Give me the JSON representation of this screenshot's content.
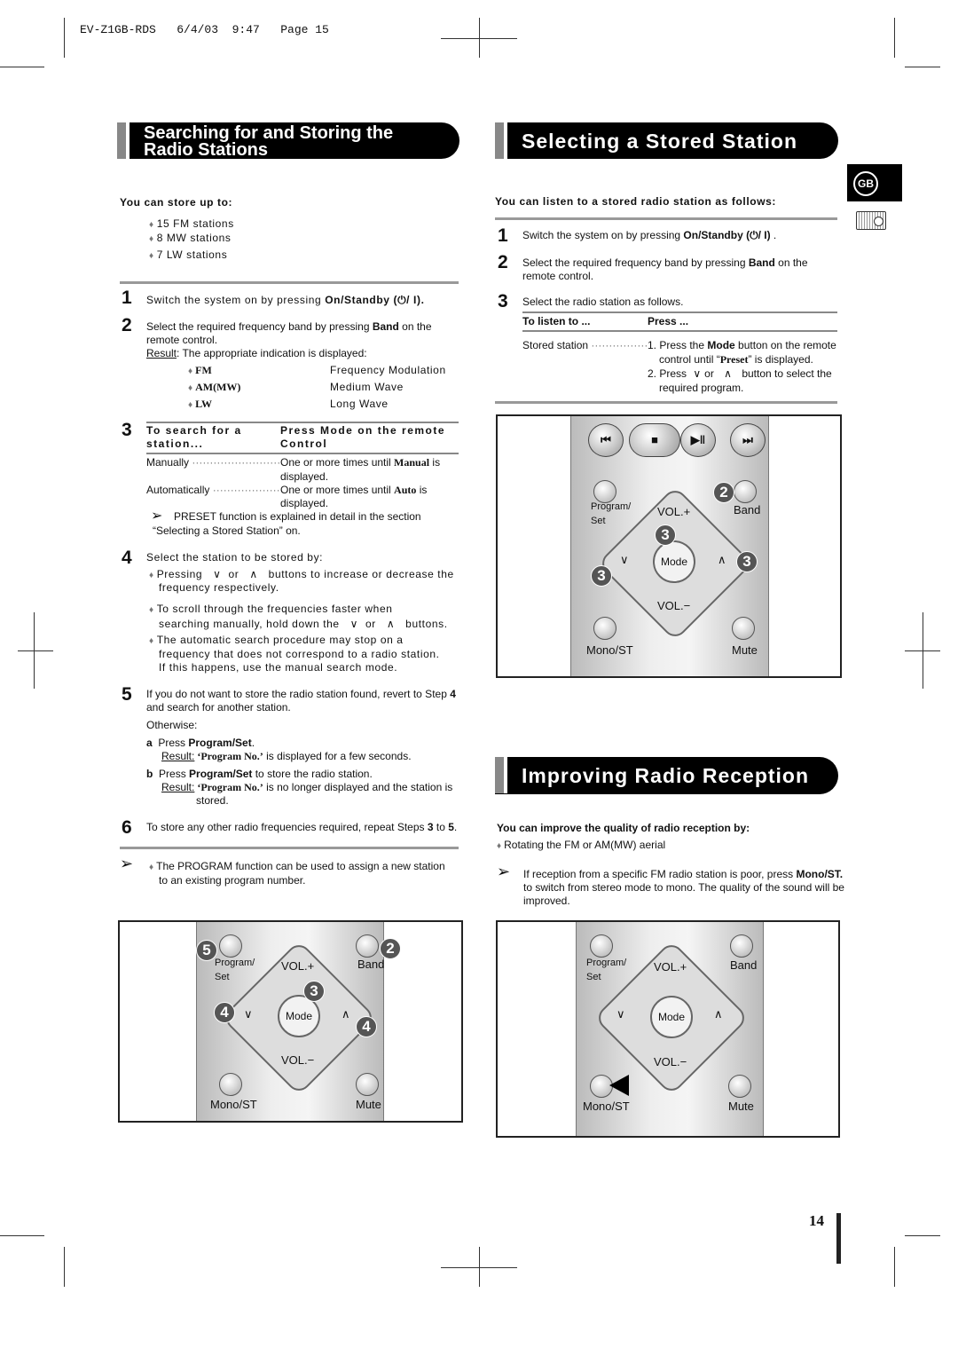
{
  "print_header": "EV-Z1GB-RDS   6/4/03  9:47   Page 15",
  "page_number": "14",
  "lang_badge": "GB",
  "icons": {
    "standby": "power-standby-icon",
    "radio": "radio-icon",
    "note": "arrow-note-icon",
    "bullet": "diamond-bullet-icon",
    "down": "v-down-icon",
    "up": "caret-up-icon"
  },
  "left": {
    "title_line1": "Searching for and Storing the",
    "title_line2": "Radio Stations",
    "store_heading": "You can store up to:",
    "store_items": [
      "15 FM stations",
      "8 MW stations",
      "7 LW stations"
    ],
    "step1": {
      "num": "1",
      "text": "Switch the system on by pressing ",
      "bold": "On/Standby (",
      "tail": "⏻/ I)."
    },
    "step2": {
      "num": "2",
      "line1a": "Select the required frequency band by pressing ",
      "line1b": "Band",
      "line1c": " on the",
      "line2": "remote control.",
      "result_label": "Result",
      "result_text": ": The appropriate indication is displayed:"
    },
    "bands": [
      {
        "code": "FM",
        "name": "Frequency Modulation"
      },
      {
        "code": "AM(MW)",
        "name": "Medium Wave"
      },
      {
        "code": "LW",
        "name": "Long Wave"
      }
    ],
    "step3": {
      "num": "3",
      "col1_line1": "To search for a",
      "col1_line2": "station...",
      "col2_line1": "Press Mode on the remote",
      "col2_line2": "Control",
      "rows": [
        {
          "label": "Manually",
          "a": "One or more times until ",
          "b": "Manual",
          "c": " is",
          "d": "displayed."
        },
        {
          "label": "Automatically",
          "a": "One or more times until ",
          "b": "Auto",
          "c": " is",
          "d": "displayed."
        }
      ],
      "note_line1": "PRESET function is explained in detail in the section",
      "note_line2": "“Selecting a Stored Station” on."
    },
    "step4": {
      "num": "4",
      "intro": "Select the station to be stored by:",
      "b1a": "Pressing",
      "b1or": "or",
      "b1b": "buttons to increase or decrease the",
      "b1c": "frequency respectively.",
      "b2a": "To scroll through the frequencies faster when",
      "b2b": "searching manually, hold down the",
      "b2or": "or",
      "b2c": "buttons.",
      "b3a": "The automatic search procedure may stop on a",
      "b3b": "frequency that does not correspond to a radio station.",
      "b3c": "If this happens, use the manual search mode."
    },
    "step5": {
      "num": "5",
      "l1a": "If you do not want to store the radio station found, revert to Step ",
      "l1b": "4",
      "l2": "and search for another station.",
      "otherwise": "Otherwise:",
      "a_label": "a",
      "a_text": "Press ",
      "a_bold": "Program/Set",
      "a_end": ".",
      "a_result": "Result:",
      "a_res_bold": " ‘Program No.’",
      "a_res_text": " is displayed for a few seconds.",
      "b_label": "b",
      "b_text": "Press ",
      "b_bold": "Program/Set",
      "b_end": " to store the radio station.",
      "b_result": "Result:",
      "b_res_bold": " ‘Program No.’",
      "b_res_text": " is no longer displayed and the station is",
      "b_res_text2": "stored."
    },
    "step6": {
      "num": "6",
      "a": "To store any other radio frequencies required, repeat Steps ",
      "b": "3",
      "c": " to ",
      "d": "5",
      "e": "."
    },
    "note_line1": "The PROGRAM function can be used to assign a new station",
    "note_line2": "to an existing program number."
  },
  "right": {
    "title": "Selecting a Stored Station",
    "heading": "You can listen to a stored radio station as follows:",
    "step1": {
      "num": "1",
      "text": "Switch the system on by pressing ",
      "bold": "On/Standby (",
      "tail": "⏻/ I)",
      "end": " ."
    },
    "step2": {
      "num": "2",
      "a": "Select the required frequency band by pressing ",
      "b": "Band",
      "c": " on the",
      "l2": "remote control."
    },
    "step3": {
      "num": "3",
      "text": "Select the radio station as follows.",
      "col1": "To listen to ...",
      "col2": "Press ...",
      "row_label": "Stored station",
      "l1a": "1. Press the ",
      "l1b": "Mode",
      "l1c": " button on the remote",
      "l2a": "control until “",
      "l2b": "Preset",
      "l2c": "” is displayed.",
      "l3a": "2. Press",
      "l3or": "or",
      "l3c": "button to select the",
      "l4": "required program."
    },
    "title2": "Improving Radio Reception",
    "improve_heading": "You can improve the quality of radio reception by:",
    "improve_bullet": "Rotating the FM or AM(MW) aerial",
    "improve_note_a": "If reception from a specific FM radio station is poor, press ",
    "improve_note_b": "Mono/ST.",
    "improve_note_l2": "to switch from stereo mode to mono. The quality of the sound will be",
    "improve_note_l3": "improved."
  },
  "remote": {
    "program": "Program/",
    "set": "Set",
    "vol_up": "VOL.+",
    "band": "Band",
    "mode": "Mode",
    "vol_down": "VOL.−",
    "mono": "Mono/ST",
    "mute": "Mute",
    "down": "∨",
    "up": "∧",
    "prev": "⏮",
    "stop": "■",
    "play": "▶‖",
    "next": "⏭"
  },
  "callouts": {
    "top": [
      "2",
      "3",
      "3",
      "3"
    ],
    "left": [
      "5",
      "2",
      "3",
      "4",
      "4"
    ]
  }
}
